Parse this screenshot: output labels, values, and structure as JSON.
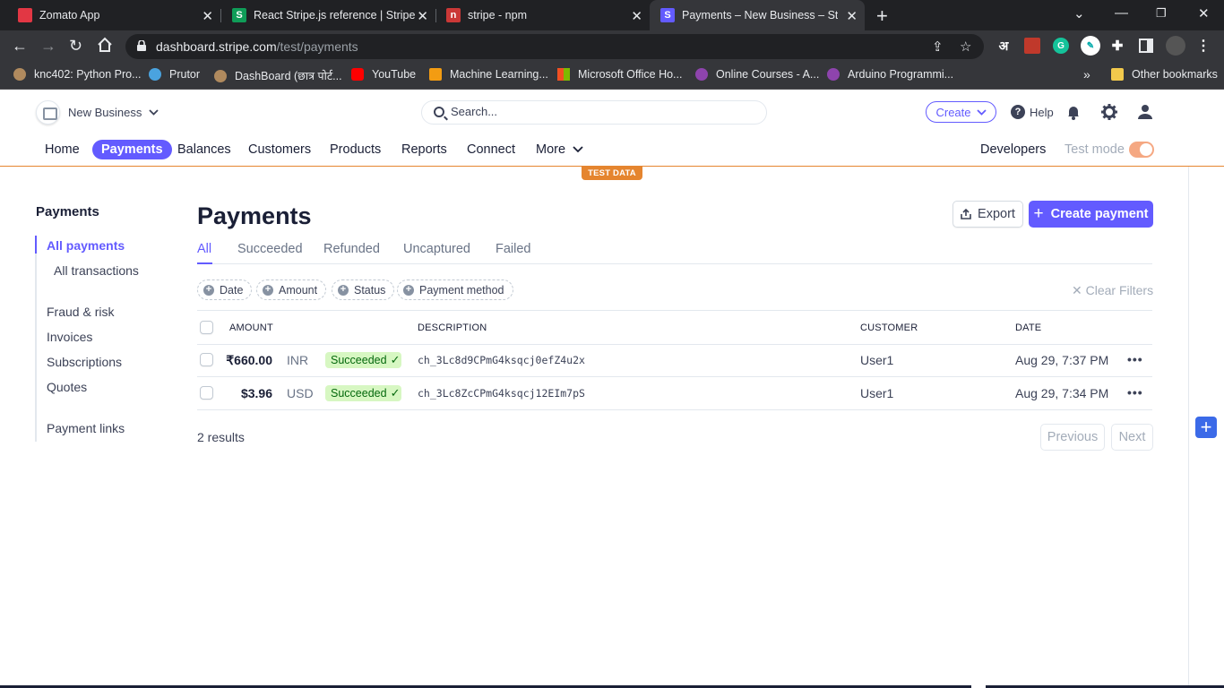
{
  "browser": {
    "tabs": [
      {
        "title": "Zomato App",
        "color": "#e23744",
        "glyph": "—"
      },
      {
        "title": "React Stripe.js reference | Stripe D",
        "color": "#0f9d58",
        "glyph": "S"
      },
      {
        "title": "stripe - npm",
        "color": "#cb3837",
        "glyph": "n"
      },
      {
        "title": "Payments – New Business – Strip",
        "color": "#635bff",
        "glyph": "S"
      }
    ],
    "url_host": "dashboard.stripe.com",
    "url_path": "/test/payments",
    "bookmarks": [
      "knc402: Python Pro...",
      "Prutor",
      "DashBoard (छात्र पोर्ट...",
      "YouTube",
      "Machine Learning...",
      "Microsoft Office Ho...",
      "Online Courses - A...",
      "Arduino Programmi..."
    ],
    "bookmarks_more": "»",
    "other_bookmarks": "Other bookmarks"
  },
  "header": {
    "account_name": "New Business",
    "search_placeholder": "Search...",
    "create_label": "Create",
    "help_label": "Help"
  },
  "nav": {
    "items": [
      "Home",
      "Payments",
      "Balances",
      "Customers",
      "Products",
      "Reports",
      "Connect",
      "More"
    ],
    "active": "Payments",
    "developers": "Developers",
    "test_mode": "Test mode",
    "test_data_badge": "TEST DATA"
  },
  "sidebar": {
    "title": "Payments",
    "items": [
      "All payments",
      "All transactions",
      "Fraud & risk",
      "Invoices",
      "Subscriptions",
      "Quotes",
      "Payment links"
    ]
  },
  "main": {
    "title": "Payments",
    "export_label": "Export",
    "create_payment_label": "Create payment",
    "tabs": [
      "All",
      "Succeeded",
      "Refunded",
      "Uncaptured",
      "Failed"
    ],
    "filters": [
      "Date",
      "Amount",
      "Status",
      "Payment method"
    ],
    "clear_filters": "Clear Filters",
    "columns": [
      "AMOUNT",
      "DESCRIPTION",
      "CUSTOMER",
      "DATE"
    ],
    "rows": [
      {
        "amount": "₹660.00",
        "currency": "INR",
        "status": "Succeeded",
        "description": "ch_3Lc8d9CPmG4ksqcj0efZ4u2x",
        "customer": "User1",
        "date": "Aug 29, 7:37 PM"
      },
      {
        "amount": "$3.96",
        "currency": "USD",
        "status": "Succeeded",
        "description": "ch_3Lc8ZcCPmG4ksqcj12EIm7pS",
        "customer": "User1",
        "date": "Aug 29, 7:34 PM"
      }
    ],
    "results_text": "2 results",
    "previous_label": "Previous",
    "next_label": "Next"
  },
  "colors": {
    "accent": "#635bff",
    "test_orange": "#e5852f",
    "success_bg": "#d7f7c2",
    "success_fg": "#05690d"
  }
}
